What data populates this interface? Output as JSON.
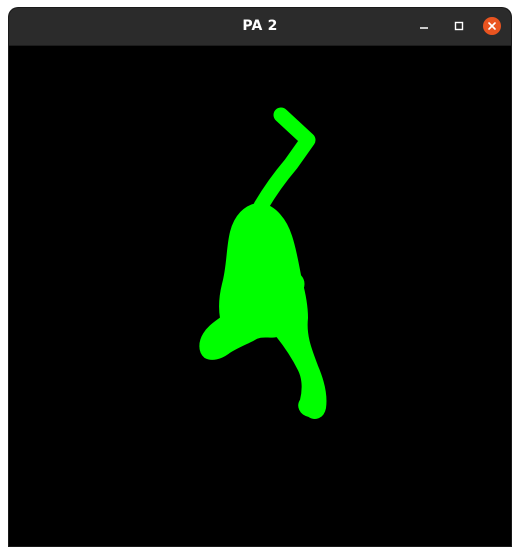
{
  "window": {
    "title": "PA 2",
    "controls": {
      "minimize_icon": "minimize-icon",
      "maximize_icon": "maximize-icon",
      "close_icon": "close-icon"
    }
  },
  "canvas": {
    "background_color": "#000000",
    "silhouette_color": "#00ff00",
    "content": "cat-silhouette"
  }
}
